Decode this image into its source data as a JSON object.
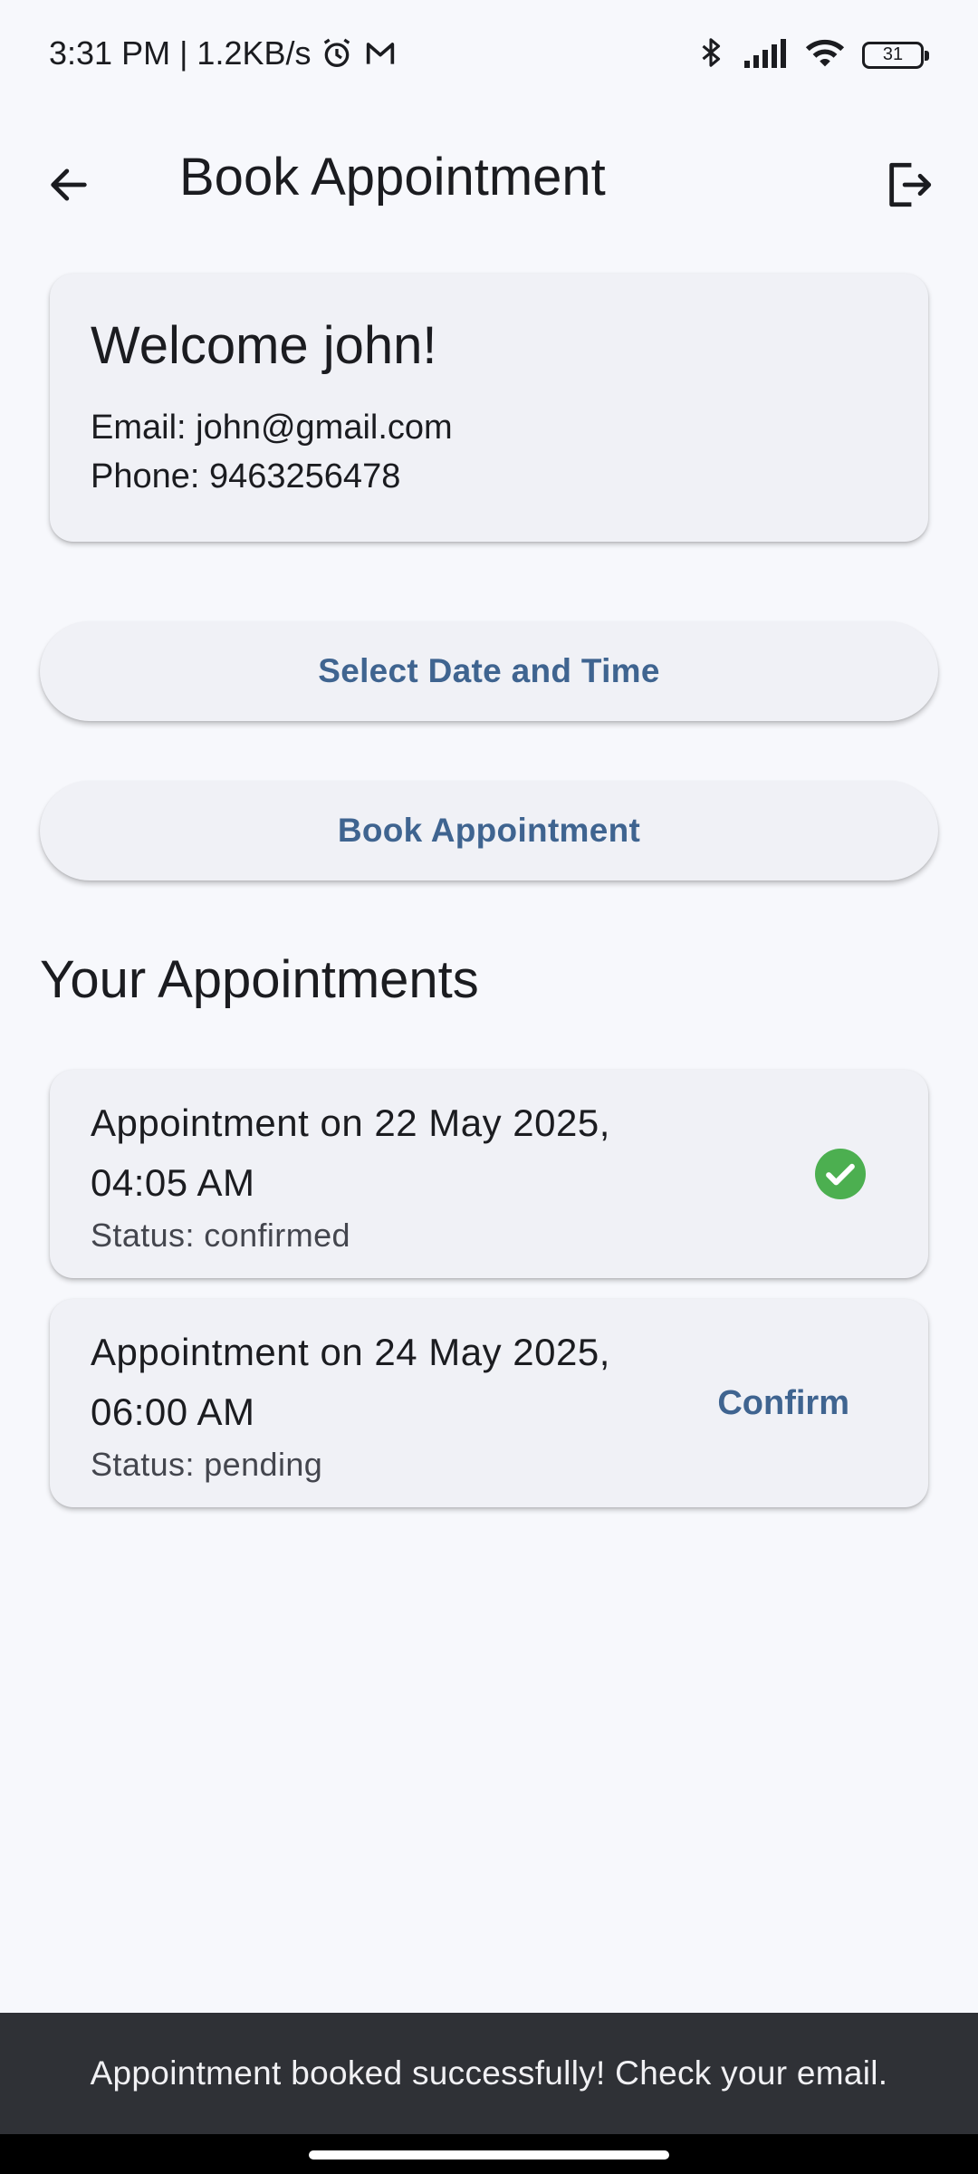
{
  "status_bar": {
    "time_speed": "3:31 PM | 1.2KB/s",
    "battery": "31"
  },
  "app_bar": {
    "title": "Book Appointment"
  },
  "welcome": {
    "title": "Welcome john!",
    "email": "Email: john@gmail.com",
    "phone": "Phone: 9463256478"
  },
  "buttons": {
    "select_datetime": "Select Date and Time",
    "book": "Book Appointment"
  },
  "appointments_section": {
    "title": "Your Appointments",
    "items": [
      {
        "title": "Appointment on 22 May 2025, 04:05 AM",
        "status": "Status: confirmed"
      },
      {
        "title": "Appointment on 24 May 2025, 06:00 AM",
        "status": "Status: pending",
        "action": "Confirm"
      }
    ]
  },
  "snackbar": {
    "message": "Appointment booked successfully! Check your email."
  },
  "colors": {
    "accent": "#3f6490",
    "success": "#4caf50",
    "background": "#f7f8fc",
    "card": "#f0f1f6",
    "snackbar": "#2f3136"
  },
  "icons": [
    "alarm-icon",
    "gmail-icon",
    "bluetooth-icon",
    "signal-icon",
    "wifi-icon",
    "battery-icon",
    "back-arrow-icon",
    "logout-icon",
    "check-circle-icon"
  ]
}
